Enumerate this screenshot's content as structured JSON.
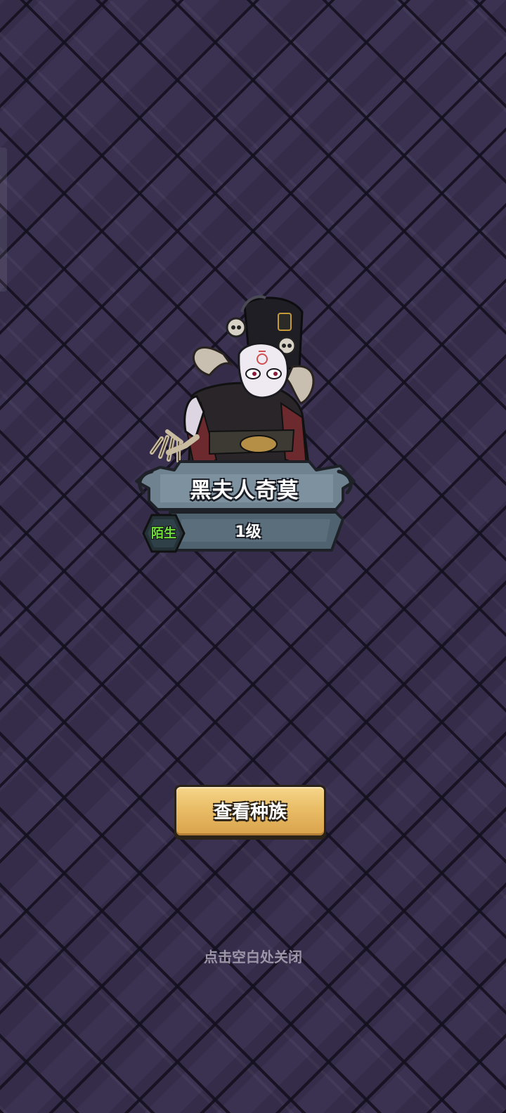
{
  "character": {
    "name": "黑夫人奇莫",
    "level": "1级",
    "relation_badge": "陌生",
    "badge_color": "#6fe03a"
  },
  "actions": {
    "view_race_label": "查看种族",
    "close_hint": "点击空白处关闭"
  },
  "colors": {
    "background": "#3b3252",
    "button_gold": "#e9bd66",
    "plate_slate": "#6a7d8c"
  }
}
